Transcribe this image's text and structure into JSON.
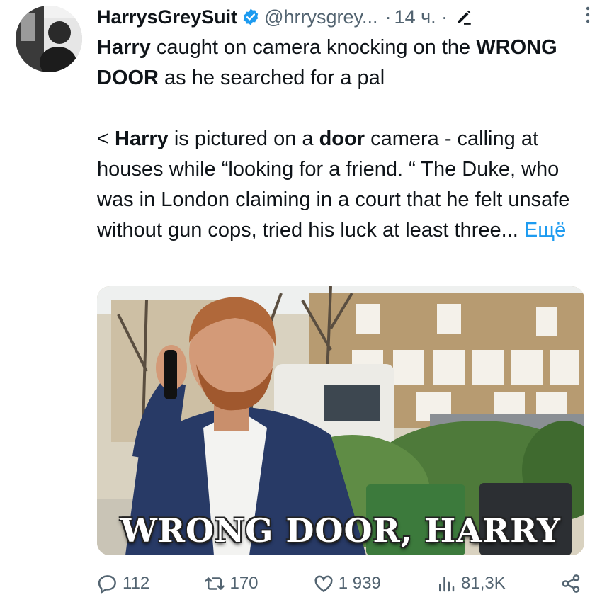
{
  "author": {
    "display_name": "HarrysGreySuit",
    "handle": "@hrrysgrey...",
    "separator": "·",
    "time": "14 ч. ·",
    "verified_color": "#1d9bf0"
  },
  "tweet": {
    "headline_bold_1": "Harry",
    "headline_text_1": " caught on camera knocking on the ",
    "headline_bold_2": "WRONG DOOR",
    "headline_text_2": " as he searched for a pal",
    "para_prefix": "< ",
    "para_bold_1": "Harry",
    "para_text_1": " is pictured on a ",
    "para_bold_2": "door",
    "para_text_2": " camera - calling at houses while “looking for a friend. “ The Duke, who was in London claiming in a court that he felt unsafe without gun cops, tried his luck at least three...",
    "more_link": " Ещё"
  },
  "media": {
    "caption": "WRONG DOOR, HARRY"
  },
  "actions": {
    "replies": "112",
    "retweets": "170",
    "likes": "1 939",
    "views": "81,3K"
  },
  "icons": {
    "reply": "reply-icon",
    "retweet": "retweet-icon",
    "like": "like-icon",
    "views": "views-icon",
    "share": "share-icon",
    "verified": "verified-badge-icon",
    "edit": "edit-pencil-icon",
    "more": "more-vertical-icon"
  }
}
